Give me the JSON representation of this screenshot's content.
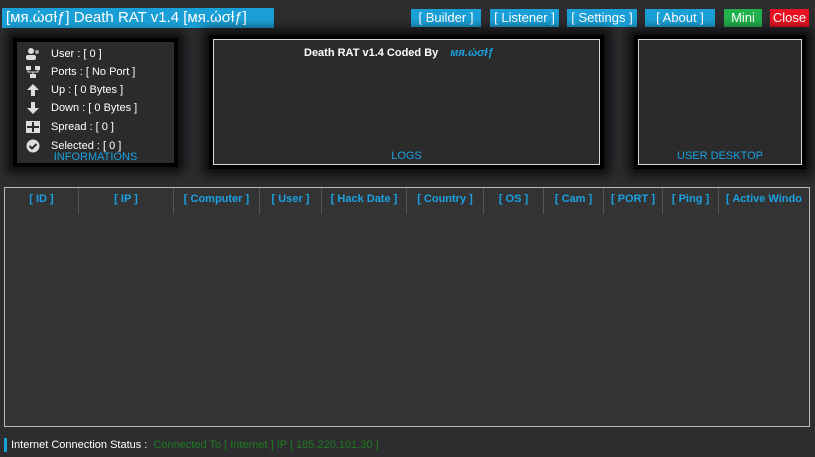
{
  "window": {
    "title": "[мя.ώσƚƒ] Death RAT v1.4 [мя.ώσƚƒ]",
    "buttons": {
      "builder": "[ Builder ]",
      "listener": "[ Listener ]",
      "settings": "[ Settings ]",
      "about": "[ About ]",
      "mini": "Mini",
      "close": "Close"
    },
    "colors": {
      "accent": "#1aa0d6",
      "mini": "#22b14c",
      "close": "#e81123",
      "status_ok": "#1f7a1f"
    }
  },
  "info_panel": {
    "caption": "INFORMATIONS",
    "rows": [
      {
        "icon": "users-icon",
        "text": "User : [ 0 ]"
      },
      {
        "icon": "network-icon",
        "text": "Ports : [ No Port ]"
      },
      {
        "icon": "arrow-up-icon",
        "text": "Up : [ 0 Bytes ]"
      },
      {
        "icon": "arrow-down-icon",
        "text": "Down : [ 0 Bytes ]"
      },
      {
        "icon": "spread-icon",
        "text": "Spread : [ 0 ]"
      },
      {
        "icon": "check-circle-icon",
        "text": "Selected : [ 0 ]"
      }
    ]
  },
  "logs_panel": {
    "caption": "LOGS",
    "header": "Death RAT v1.4   Coded By",
    "signature": "мя.ώσƚƒ"
  },
  "desktop_panel": {
    "caption": "USER DESKTOP"
  },
  "grid": {
    "columns": [
      "[ ID ]",
      "[ IP ]",
      "[ Computer ]",
      "[ User ]",
      "[ Hack Date ]",
      "[ Country ]",
      "[ OS ]",
      "[ Cam ]",
      "[ PORT ]",
      "[ Ping ]",
      "[ Active Windo"
    ]
  },
  "status": {
    "label": "Internet Connection Status :",
    "value": "Connected To [ Internet ] IP [ 185.220.101.30 ]"
  }
}
